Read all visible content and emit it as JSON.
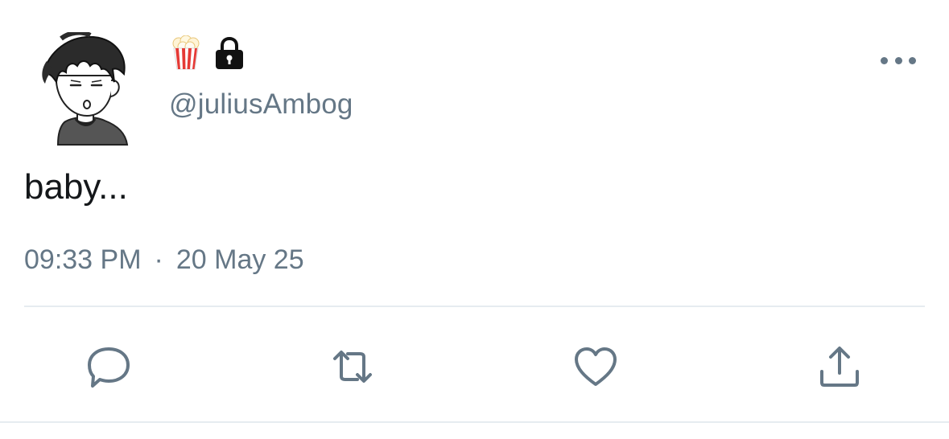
{
  "tweet": {
    "handle": "@juliusAmbog",
    "name_emojis": [
      "popcorn-icon",
      "lock-icon"
    ],
    "text": "baby...",
    "time": "09:33 PM",
    "separator": "·",
    "date": "20 May 25"
  },
  "actions": [
    "reply",
    "retweet",
    "like",
    "share"
  ],
  "colors": {
    "text": "#14171a",
    "secondary": "#657786",
    "divider": "#e6ecf0"
  }
}
